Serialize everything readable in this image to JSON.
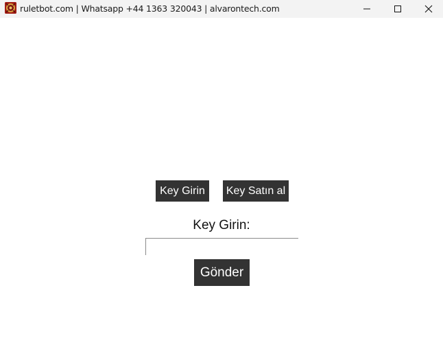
{
  "window": {
    "title": "ruletbot.com | Whatsapp +44 1363 320043 | alvarontech.com",
    "icon": "roulette-app-icon",
    "controls": {
      "minimize_icon": "minimize-icon",
      "maximize_icon": "maximize-icon",
      "close_icon": "close-icon"
    }
  },
  "main": {
    "tabs": [
      {
        "label": "Key Girin"
      },
      {
        "label": "Key Satın al"
      }
    ],
    "form": {
      "label": "Key Girin:",
      "input_value": "",
      "input_placeholder": "",
      "submit_label": "Gönder"
    }
  },
  "colors": {
    "button_bg": "#333333",
    "button_text": "#ffffff",
    "titlebar_bg": "#f3f3f3",
    "app_icon": "#b3261e"
  }
}
